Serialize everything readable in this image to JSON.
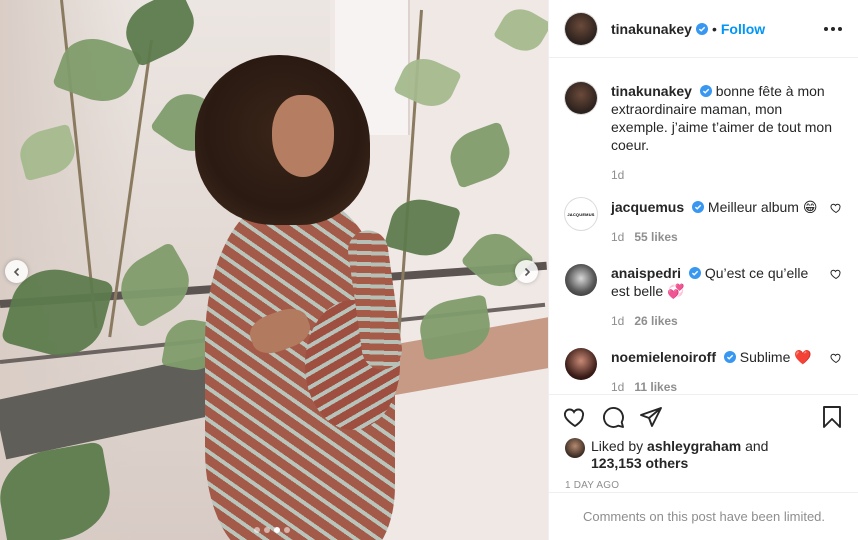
{
  "post": {
    "author": "tinakunakey",
    "follow_label": "Follow",
    "separator": "•"
  },
  "caption": {
    "username": "tinakunakey",
    "text": "bonne fête à mon extraordinaire maman, mon exemple. j’aime t’aimer de tout mon coeur.",
    "time": "1d"
  },
  "comments": [
    {
      "username": "jacquemus",
      "text": "Meilleur album 😁",
      "time": "1d",
      "likes": "55 likes",
      "avatar_text": "JACQUEMUS"
    },
    {
      "username": "anaispedri",
      "text": "Qu’est ce qu’elle est belle 💞",
      "time": "1d",
      "likes": "26 likes"
    },
    {
      "username": "noemielenoiroff",
      "text": "Sublime ❤️",
      "time": "1d",
      "likes": "11 likes"
    }
  ],
  "likes": {
    "prefix": "Liked by",
    "user": "ashleygraham",
    "and": "and",
    "others": "123,153 others"
  },
  "posted_ago": "1 DAY AGO",
  "comments_limited": "Comments on this post have been limited.",
  "colors": {
    "accent": "#0095f6",
    "verified": "#3897f0",
    "muted": "#8e8e8e"
  },
  "carousel": {
    "total": 4,
    "current": 3
  }
}
